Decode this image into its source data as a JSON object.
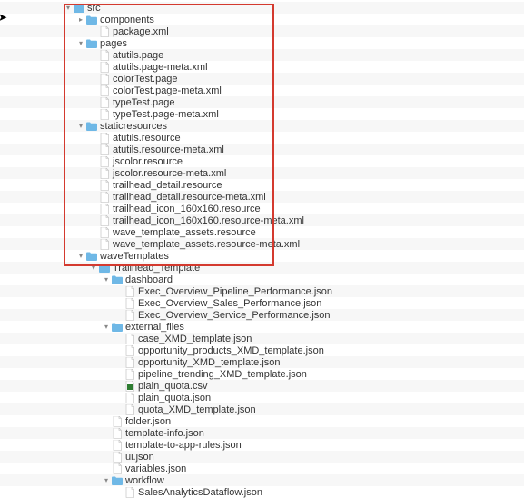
{
  "tree": [
    {
      "depth": 0,
      "arrow": "down",
      "icon": "folder",
      "label": "src"
    },
    {
      "depth": 1,
      "arrow": "right",
      "icon": "folder",
      "label": "components"
    },
    {
      "depth": 2,
      "arrow": "none",
      "icon": "file",
      "label": "package.xml"
    },
    {
      "depth": 1,
      "arrow": "down",
      "icon": "folder",
      "label": "pages"
    },
    {
      "depth": 2,
      "arrow": "none",
      "icon": "file",
      "label": "atutils.page"
    },
    {
      "depth": 2,
      "arrow": "none",
      "icon": "file",
      "label": "atutils.page-meta.xml"
    },
    {
      "depth": 2,
      "arrow": "none",
      "icon": "file",
      "label": "colorTest.page"
    },
    {
      "depth": 2,
      "arrow": "none",
      "icon": "file",
      "label": "colorTest.page-meta.xml"
    },
    {
      "depth": 2,
      "arrow": "none",
      "icon": "file",
      "label": "typeTest.page"
    },
    {
      "depth": 2,
      "arrow": "none",
      "icon": "file",
      "label": "typeTest.page-meta.xml"
    },
    {
      "depth": 1,
      "arrow": "down",
      "icon": "folder",
      "label": "staticresources"
    },
    {
      "depth": 2,
      "arrow": "none",
      "icon": "file",
      "label": "atutils.resource"
    },
    {
      "depth": 2,
      "arrow": "none",
      "icon": "file",
      "label": "atutils.resource-meta.xml"
    },
    {
      "depth": 2,
      "arrow": "none",
      "icon": "file",
      "label": "jscolor.resource"
    },
    {
      "depth": 2,
      "arrow": "none",
      "icon": "file",
      "label": "jscolor.resource-meta.xml"
    },
    {
      "depth": 2,
      "arrow": "none",
      "icon": "file",
      "label": "trailhead_detail.resource"
    },
    {
      "depth": 2,
      "arrow": "none",
      "icon": "file",
      "label": "trailhead_detail.resource-meta.xml"
    },
    {
      "depth": 2,
      "arrow": "none",
      "icon": "file",
      "label": "trailhead_icon_160x160.resource"
    },
    {
      "depth": 2,
      "arrow": "none",
      "icon": "file",
      "label": "trailhead_icon_160x160.resource-meta.xml"
    },
    {
      "depth": 2,
      "arrow": "none",
      "icon": "file",
      "label": "wave_template_assets.resource"
    },
    {
      "depth": 2,
      "arrow": "none",
      "icon": "file",
      "label": "wave_template_assets.resource-meta.xml"
    },
    {
      "depth": 1,
      "arrow": "down",
      "icon": "folder",
      "label": "waveTemplates"
    },
    {
      "depth": 2,
      "arrow": "down",
      "icon": "folder",
      "label": "Trailhead_Template"
    },
    {
      "depth": 3,
      "arrow": "down",
      "icon": "folder",
      "label": "dashboard"
    },
    {
      "depth": 4,
      "arrow": "none",
      "icon": "file",
      "label": "Exec_Overview_Pipeline_Performance.json"
    },
    {
      "depth": 4,
      "arrow": "none",
      "icon": "file",
      "label": "Exec_Overview_Sales_Performance.json"
    },
    {
      "depth": 4,
      "arrow": "none",
      "icon": "file",
      "label": "Exec_Overview_Service_Performance.json"
    },
    {
      "depth": 3,
      "arrow": "down",
      "icon": "folder",
      "label": "external_files"
    },
    {
      "depth": 4,
      "arrow": "none",
      "icon": "file",
      "label": "case_XMD_template.json"
    },
    {
      "depth": 4,
      "arrow": "none",
      "icon": "file",
      "label": "opportunity_products_XMD_template.json"
    },
    {
      "depth": 4,
      "arrow": "none",
      "icon": "file",
      "label": "opportunity_XMD_template.json"
    },
    {
      "depth": 4,
      "arrow": "none",
      "icon": "file",
      "label": "pipeline_trending_XMD_template.json"
    },
    {
      "depth": 4,
      "arrow": "none",
      "icon": "csv",
      "label": "plain_quota.csv"
    },
    {
      "depth": 4,
      "arrow": "none",
      "icon": "file",
      "label": "plain_quota.json"
    },
    {
      "depth": 4,
      "arrow": "none",
      "icon": "file",
      "label": "quota_XMD_template.json"
    },
    {
      "depth": 3,
      "arrow": "none",
      "icon": "file",
      "label": "folder.json"
    },
    {
      "depth": 3,
      "arrow": "none",
      "icon": "file",
      "label": "template-info.json"
    },
    {
      "depth": 3,
      "arrow": "none",
      "icon": "file",
      "label": "template-to-app-rules.json"
    },
    {
      "depth": 3,
      "arrow": "none",
      "icon": "file",
      "label": "ui.json"
    },
    {
      "depth": 3,
      "arrow": "none",
      "icon": "file",
      "label": "variables.json"
    },
    {
      "depth": 3,
      "arrow": "down",
      "icon": "folder",
      "label": "workflow"
    },
    {
      "depth": 4,
      "arrow": "none",
      "icon": "file",
      "label": "SalesAnalyticsDataflow.json"
    }
  ],
  "base_indent": 70,
  "indent_step": 14
}
